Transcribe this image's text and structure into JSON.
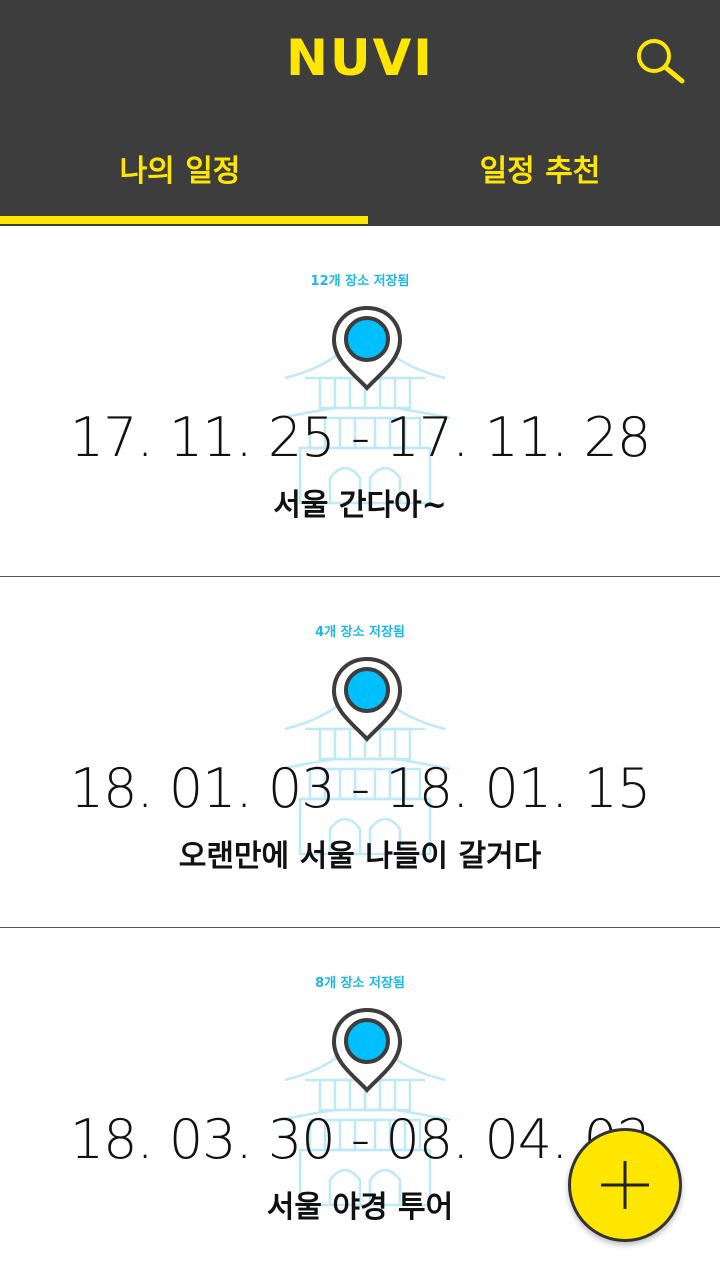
{
  "app": {
    "logo": "NUVI"
  },
  "header": {
    "search_icon": "search-icon"
  },
  "tabs": [
    {
      "label": "나의 일정",
      "active": true
    },
    {
      "label": "일정 추천",
      "active": false
    }
  ],
  "colors": {
    "header_bg": "#3d3d3d",
    "accent": "#ffe600",
    "pin_fill": "#00bfff",
    "count_text": "#1fb6e6"
  },
  "trips": [
    {
      "saved_count": "12개 장소 저장됨",
      "date_range": "17. 11. 25 - 17. 11. 28",
      "title": "서울 간다아~"
    },
    {
      "saved_count": "4개 장소 저장됨",
      "date_range": "18. 01. 03 - 18. 01. 15",
      "title": "오랜만에 서울 나들이 갈거다"
    },
    {
      "saved_count": "8개 장소 저장됨",
      "date_range": "18. 03. 30 - 08. 04. 02",
      "title": "서울 야경 투어"
    }
  ],
  "fab": {
    "icon": "plus-icon"
  }
}
